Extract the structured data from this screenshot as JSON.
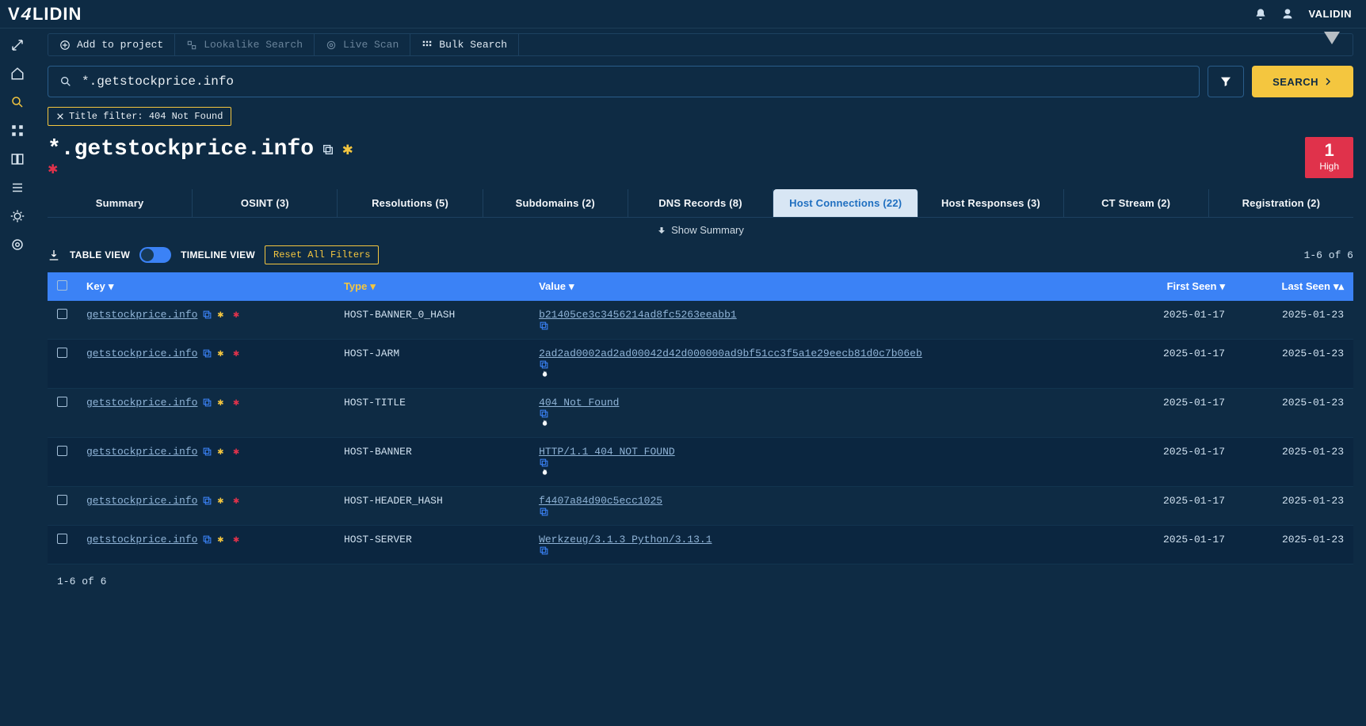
{
  "app": {
    "username": "VALIDIN"
  },
  "nav": {
    "items": [
      "expand",
      "home",
      "search",
      "grid",
      "panel",
      "list",
      "bug",
      "target"
    ]
  },
  "toolbar": {
    "add": "Add to project",
    "lookalike": "Lookalike Search",
    "livescan": "Live Scan",
    "bulk": "Bulk Search"
  },
  "search": {
    "query": "*.getstockprice.info",
    "button": "SEARCH"
  },
  "chip": {
    "text": "Title filter: 404 Not Found"
  },
  "page": {
    "title": "*.getstockprice.info",
    "risk_score": "1",
    "risk_label": "High"
  },
  "tabs": [
    {
      "label": "Summary"
    },
    {
      "label": "OSINT (3)"
    },
    {
      "label": "Resolutions (5)"
    },
    {
      "label": "Subdomains (2)"
    },
    {
      "label": "DNS Records (8)"
    },
    {
      "label": "Host Connections (22)",
      "active": true
    },
    {
      "label": "Host Responses (3)"
    },
    {
      "label": "CT Stream (2)"
    },
    {
      "label": "Registration (2)"
    }
  ],
  "summarybar": "Show Summary",
  "view": {
    "download": "download",
    "table": "TABLE VIEW",
    "timeline": "TIMELINE VIEW",
    "reset": "Reset All Filters",
    "count": "1-6 of 6"
  },
  "columns": {
    "key": "Key",
    "type": "Type",
    "value": "Value",
    "first": "First Seen",
    "last": "Last Seen"
  },
  "rows": [
    {
      "key": "getstockprice.info",
      "type": "HOST-BANNER_0_HASH",
      "value": "b21405ce3c3456214ad8fc5263eeabb1",
      "flame": false,
      "first": "2025-01-17",
      "last": "2025-01-23"
    },
    {
      "key": "getstockprice.info",
      "type": "HOST-JARM",
      "value": "2ad2ad0002ad2ad00042d42d000000ad9bf51cc3f5a1e29eecb81d0c7b06eb",
      "flame": true,
      "first": "2025-01-17",
      "last": "2025-01-23"
    },
    {
      "key": "getstockprice.info",
      "type": "HOST-TITLE",
      "value": "404 Not Found",
      "flame": true,
      "first": "2025-01-17",
      "last": "2025-01-23"
    },
    {
      "key": "getstockprice.info",
      "type": "HOST-BANNER",
      "value": "HTTP/1.1 404 NOT FOUND",
      "flame": true,
      "first": "2025-01-17",
      "last": "2025-01-23"
    },
    {
      "key": "getstockprice.info",
      "type": "HOST-HEADER_HASH",
      "value": "f4407a84d90c5ecc1025",
      "flame": false,
      "first": "2025-01-17",
      "last": "2025-01-23"
    },
    {
      "key": "getstockprice.info",
      "type": "HOST-SERVER",
      "value": "Werkzeug/3.1.3 Python/3.13.1",
      "flame": false,
      "first": "2025-01-17",
      "last": "2025-01-23"
    }
  ],
  "footer_count": "1-6 of 6"
}
